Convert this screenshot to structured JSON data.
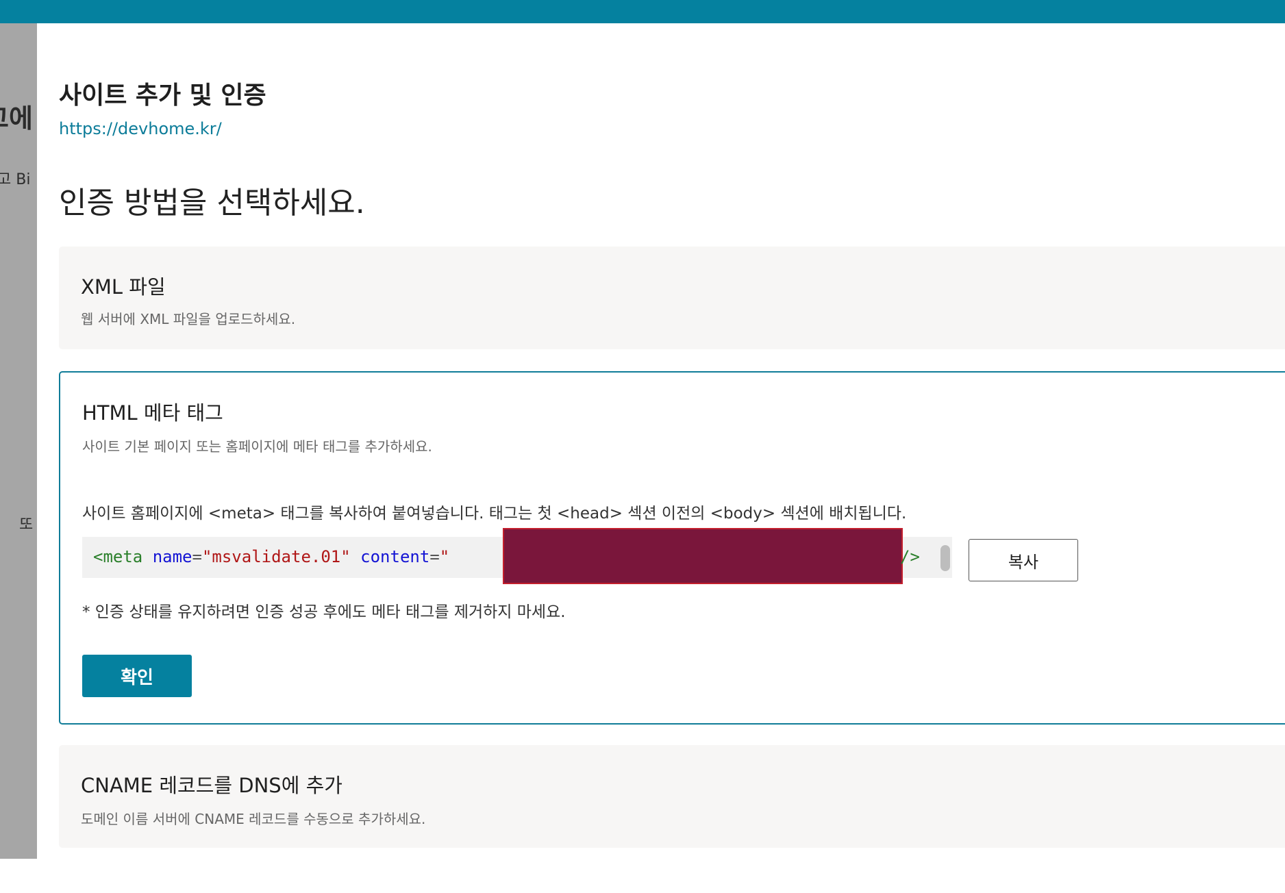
{
  "background": {
    "heading_fragment": "고에",
    "sub_fragment": "고 Bi",
    "or_fragment": "또"
  },
  "dialog": {
    "title": "사이트 추가 및 인증",
    "url": "https://devhome.kr/",
    "subtitle": "인증 방법을 선택하세요."
  },
  "methods": {
    "xml": {
      "title": "XML 파일",
      "description": "웹 서버에 XML 파일을 업로드하세요."
    },
    "html_meta": {
      "title": "HTML 메타 태그",
      "description": "사이트 기본 페이지 또는 홈페이지에 메타 태그를 추가하세요.",
      "instruction": "사이트 홈페이지에 <meta> 태그를 복사하여 붙여넣습니다. 태그는 첫 <head> 섹션 이전의 <body> 섹션에 배치됩니다.",
      "code": {
        "tag_open": "<meta",
        "attr_name": "name",
        "eq": "=",
        "name_value": "\"msvalidate.01\"",
        "attr_content": "content",
        "content_prefix": "\"",
        "tag_close": "/>"
      },
      "copy_label": "복사",
      "note": "* 인증 상태를 유지하려면 인증 성공 후에도 메타 태그를 제거하지 마세요.",
      "confirm_label": "확인"
    },
    "cname": {
      "title": "CNAME 레코드를 DNS에 추가",
      "description": "도메인 이름 서버에 CNAME 레코드를 수동으로 추가하세요."
    }
  },
  "colors": {
    "accent": "#05819f",
    "link": "#0c7c99",
    "redaction": "#7a163b"
  }
}
